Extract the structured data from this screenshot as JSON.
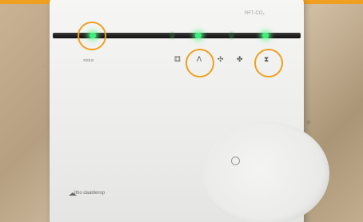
{
  "device": {
    "model_label": "RFT-CO₂",
    "status_text": "status",
    "brand": "itho daalderop"
  },
  "icons": {
    "mode_auto": "⚃",
    "fan_low": "ⴷ",
    "fan_medium": "✣",
    "fan_high": "✤",
    "timer": "⧗"
  },
  "colors": {
    "highlight": "#f0a020",
    "led_on": "#3bf07a",
    "panel": "#f0f0ee"
  }
}
